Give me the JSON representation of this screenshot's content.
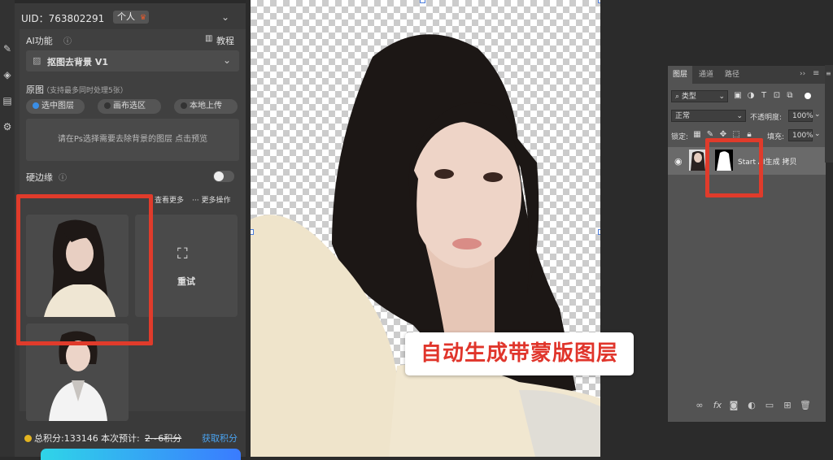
{
  "toolbar": {
    "icons": [
      "brush-icon",
      "layers-icon",
      "document-icon",
      "gear-icon"
    ]
  },
  "plugin": {
    "uid": "UID：763802291",
    "account_badge": "个人",
    "ai_function_label": "AI功能",
    "tutorial_label": "教程",
    "selected_function": "抠图去背景 V1",
    "source_label": "原图",
    "source_hint": "（支持最多同时处理5张）",
    "source_options": [
      "选中图层",
      "画布选区",
      "本地上传"
    ],
    "source_selected": "选中图层",
    "hint_text": "请在Ps选择需要去除背景的图层 点击预览",
    "hard_edge_label": "硬边缘",
    "hard_edge_on": false,
    "view_more": "查看更多",
    "more_ops": "··· 更多操作",
    "retry_label": "重试",
    "credits_text": "总积分:133146",
    "estimate_label": "本次预计:",
    "estimate_value": "2~6积分",
    "get_credits": "获取积分"
  },
  "canvas": {
    "callout_text": "自动生成带蒙版图层"
  },
  "layers_panel": {
    "tabs": [
      "图层",
      "通道",
      "路径"
    ],
    "active_tab": "图层",
    "filter_kind": "类型",
    "blend_mode": "正常",
    "opacity_label": "不透明度:",
    "opacity_value": "100%",
    "lock_label": "锁定:",
    "fill_label": "填充:",
    "fill_value": "100%",
    "layer_name": "Start  AI生成 拷贝"
  },
  "colors": {
    "highlight_red": "#e03b2b",
    "callout_red": "#e0352b",
    "accent_blue": "#3a8ee6"
  }
}
